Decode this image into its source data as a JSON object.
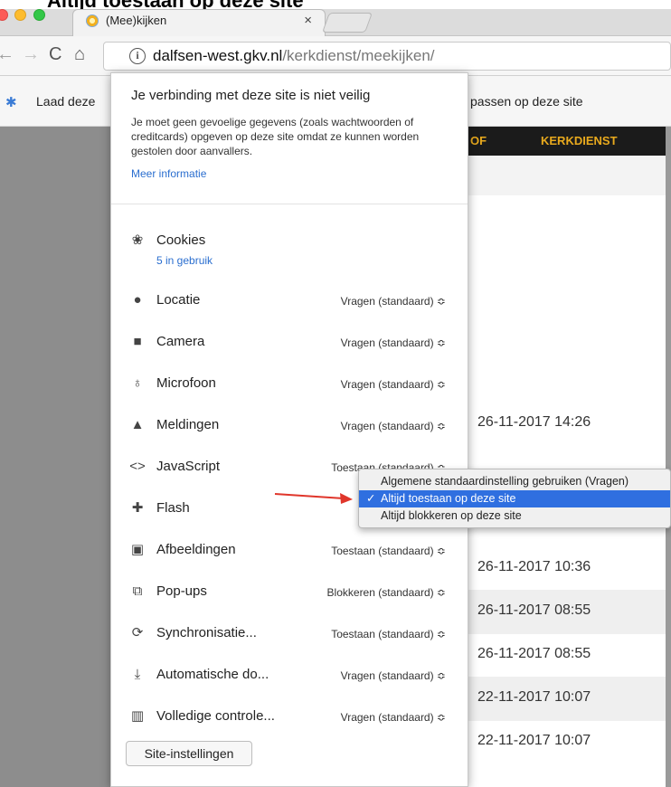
{
  "caption": {
    "text": "Altijd toestaan op deze site"
  },
  "tab": {
    "title": "(Mee)kijken",
    "close_icon": "close-icon"
  },
  "toolbar": {
    "back_icon": "arrow-left-icon",
    "forward_icon": "arrow-right-icon",
    "reload_icon": "reload-icon",
    "home_icon": "home-icon",
    "info_icon": "info-icon",
    "url_host": "dalfsen-west.gkv.nl",
    "url_path": "/kerkdienst/meekijken/"
  },
  "bookmarks": {
    "left_label": "Laad deze",
    "right_label": "passen op deze site"
  },
  "page": {
    "header_left": "OF",
    "header_right": "KERKDIENST",
    "rows": [
      {
        "date": "26-11-2017 14:26",
        "alt": false
      },
      {
        "date": "26-11-2017 10:36",
        "alt": false
      },
      {
        "date": "26-11-2017 08:55",
        "alt": true
      },
      {
        "date": "26-11-2017 08:55",
        "alt": false
      },
      {
        "date": "22-11-2017 10:07",
        "alt": true
      },
      {
        "date": "22-11-2017 10:07",
        "alt": false
      }
    ]
  },
  "popup": {
    "title": "Je verbinding met deze site is niet veilig",
    "description": "Je moet geen gevoelige gegevens (zoals wachtwoorden of creditcards) opgeven op deze site omdat ze kunnen worden gestolen door aanvallers.",
    "more_info": "Meer informatie",
    "cookies": {
      "label": "Cookies",
      "sub": "5 in gebruik",
      "icon": "cookie-icon"
    },
    "permissions": [
      {
        "label": "Locatie",
        "value": "Vragen (standaard) ≎",
        "icon": "location-pin-icon",
        "glyph": "⬤"
      },
      {
        "label": "Camera",
        "value": "Vragen (standaard) ≎",
        "icon": "camera-icon",
        "glyph": "■"
      },
      {
        "label": "Microfoon",
        "value": "Vragen (standaard) ≎",
        "icon": "microphone-icon",
        "glyph": "🎙"
      },
      {
        "label": "Meldingen",
        "value": "Vragen (standaard) ≎",
        "icon": "bell-icon",
        "glyph": "🔔"
      },
      {
        "label": "JavaScript",
        "value": "Toestaan (standaard) ≎",
        "icon": "code-icon",
        "glyph": "<>"
      },
      {
        "label": "Flash",
        "value": "",
        "icon": "puzzle-icon",
        "glyph": "✚"
      },
      {
        "label": "Afbeeldingen",
        "value": "Toestaan (standaard) ≎",
        "icon": "image-icon",
        "glyph": "▲"
      },
      {
        "label": "Pop-ups",
        "value": "Blokkeren (standaard) ≎",
        "icon": "popup-blocked-icon",
        "glyph": "⧉"
      },
      {
        "label": "Synchronisatie...",
        "value": "Toestaan (standaard) ≎",
        "icon": "sync-icon",
        "glyph": "⟳"
      },
      {
        "label": "Automatische do...",
        "value": "Vragen (standaard) ≎",
        "icon": "download-icon",
        "glyph": "⤓"
      },
      {
        "label": "Volledige controle...",
        "value": "Vragen (standaard) ≎",
        "icon": "midi-keyboard-icon",
        "glyph": "▥"
      }
    ],
    "site_settings": "Site-instellingen"
  },
  "flash_menu": {
    "items": [
      {
        "label": "Algemene standaardinstelling gebruiken (Vragen)",
        "selected": false
      },
      {
        "label": "Altijd toestaan op deze site",
        "selected": true
      },
      {
        "label": "Altijd blokkeren op deze site",
        "selected": false
      }
    ],
    "check_glyph": "✓"
  },
  "colors": {
    "accent_blue": "#2f6fe0",
    "link_blue": "#2a6ecf",
    "page_header_gold": "#e8a91d",
    "arrow_red": "#e0362b"
  }
}
